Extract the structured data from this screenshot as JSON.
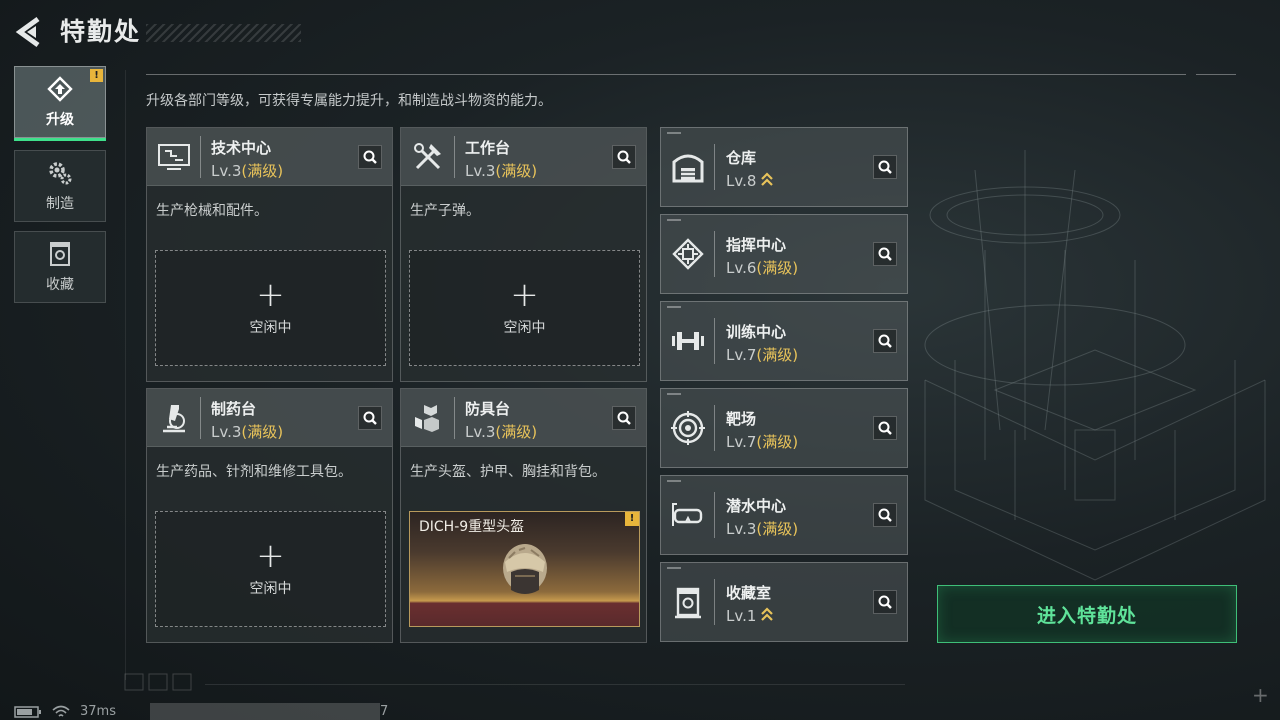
{
  "header": {
    "title": "特勤处"
  },
  "sidebar": {
    "tabs": [
      {
        "label": "升级",
        "icon": "upgrade-icon",
        "active": true,
        "alert": "!"
      },
      {
        "label": "制造",
        "icon": "gears-icon"
      },
      {
        "label": "收藏",
        "icon": "collection-icon"
      }
    ]
  },
  "subtitle": "升级各部门等级，可获得专属能力提升，和制造战斗物资的能力。",
  "departments": [
    {
      "name": "技术中心",
      "level": "Lv.3",
      "status": "(满级)",
      "desc": "生产枪械和配件。",
      "slot_plus": "+",
      "slot_text": "空闲中",
      "icon": "computer-icon"
    },
    {
      "name": "工作台",
      "level": "Lv.3",
      "status": "(满级)",
      "desc": "生产子弹。",
      "slot_plus": "+",
      "slot_text": "空闲中",
      "icon": "tools-icon"
    },
    {
      "name": "制药台",
      "level": "Lv.3",
      "status": "(满级)",
      "desc": "生产药品、针剂和维修工具包。",
      "slot_plus": "+",
      "slot_text": "空闲中",
      "icon": "microscope-icon"
    },
    {
      "name": "防具台",
      "level": "Lv.3",
      "status": "(满级)",
      "desc": "生产头盔、护甲、胸挂和背包。",
      "product": "DICH-9重型头盔",
      "product_alert": "!",
      "icon": "armor-icon"
    }
  ],
  "facilities": [
    {
      "name": "仓库",
      "level": "Lv.8",
      "status": "",
      "upgradable": true,
      "icon": "warehouse-icon"
    },
    {
      "name": "指挥中心",
      "level": "Lv.6",
      "status": "(满级)",
      "icon": "chip-icon"
    },
    {
      "name": "训练中心",
      "level": "Lv.7",
      "status": "(满级)",
      "icon": "dumbbell-icon"
    },
    {
      "name": "靶场",
      "level": "Lv.7",
      "status": "(满级)",
      "icon": "target-icon"
    },
    {
      "name": "潜水中心",
      "level": "Lv.3",
      "status": "(满级)",
      "icon": "diving-mask-icon"
    },
    {
      "name": "收藏室",
      "level": "Lv.1",
      "status": "",
      "upgradable": true,
      "icon": "vault-icon"
    }
  ],
  "enter_button": "进入特勤处",
  "status_bar": {
    "ping": "37ms",
    "uid_tail": "7"
  },
  "colors": {
    "accent_green": "#3fe08b",
    "max_level_gold": "#e8c35a",
    "alert_yellow": "#e8b53b"
  }
}
